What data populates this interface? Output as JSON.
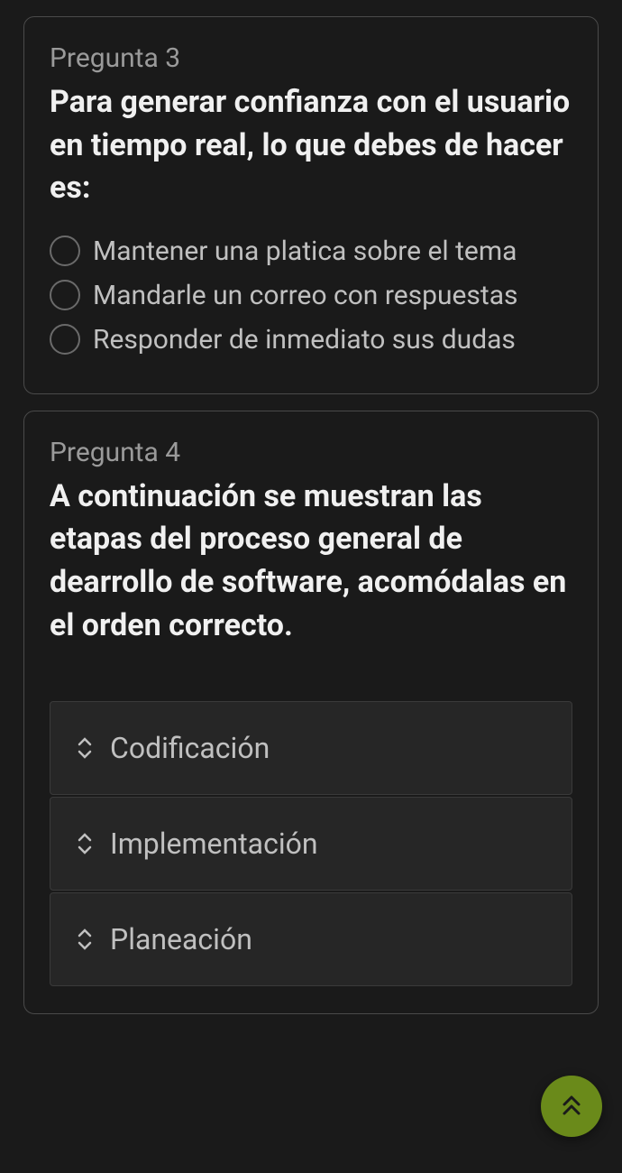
{
  "questions": [
    {
      "number": "Pregunta 3",
      "title": "Para generar confianza con el usuario en tiempo real, lo que debes de hacer es:",
      "options": [
        "Mantener una platica sobre el tema",
        "Mandarle un correo con respuestas",
        "Responder de inmediato sus dudas"
      ]
    },
    {
      "number": "Pregunta 4",
      "title": "A continuación se muestran las etapas del proceso general de dearrollo de software, acomódalas en el orden correcto.",
      "sortItems": [
        "Codificación",
        "Implementación",
        "Planeación"
      ]
    }
  ]
}
